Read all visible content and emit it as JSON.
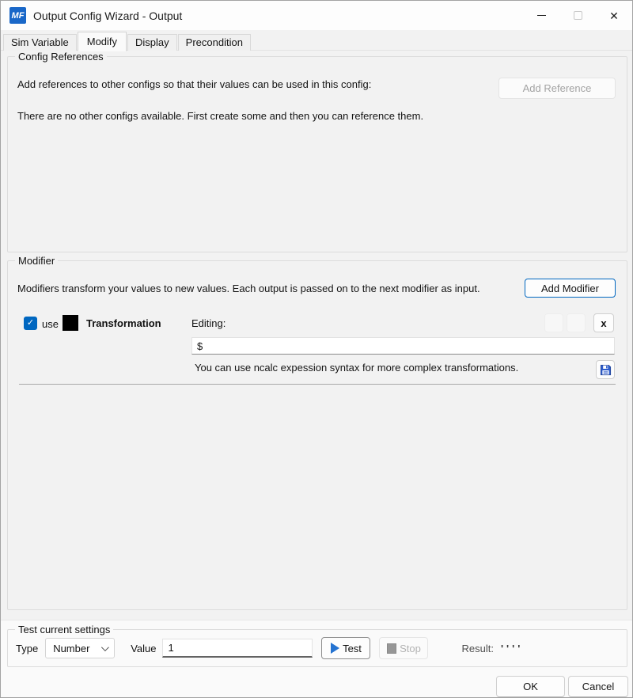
{
  "window": {
    "title": "Output Config Wizard - Output",
    "icon_text": "MF"
  },
  "icons": {
    "close_glyph": "✕",
    "check_glyph": "✓"
  },
  "tabs": [
    {
      "label": "Sim Variable",
      "active": false
    },
    {
      "label": "Modify",
      "active": true
    },
    {
      "label": "Display",
      "active": false
    },
    {
      "label": "Precondition",
      "active": false
    }
  ],
  "config_references": {
    "legend": "Config References",
    "description": "Add references to other configs so that their values can be used in this config:",
    "add_button": "Add Reference",
    "empty_message": "There are no other configs available. First create some and then you can reference them."
  },
  "modifier": {
    "legend": "Modifier",
    "description": "Modifiers transform your values to new values. Each output is passed on to the next modifier as input.",
    "add_button": "Add Modifier",
    "row": {
      "use_label": "use",
      "name": "Transformation",
      "editing_label": "Editing:",
      "expression_value": "$",
      "hint": "You can use ncalc expession syntax for more complex transformations.",
      "delete_glyph": "x"
    }
  },
  "test": {
    "legend": "Test current settings",
    "type_label": "Type",
    "type_value": "Number",
    "value_label": "Value",
    "value_input": "1",
    "test_button": "Test",
    "stop_button": "Stop",
    "result_label": "Result:",
    "result_value": "''''"
  },
  "footer": {
    "ok": "OK",
    "cancel": "Cancel"
  },
  "colors": {
    "accent_blue": "#0067c0",
    "titlebar_bg": "#fdfdfd",
    "body_bg": "#f2f2f2",
    "swatch_black": "#000000"
  }
}
